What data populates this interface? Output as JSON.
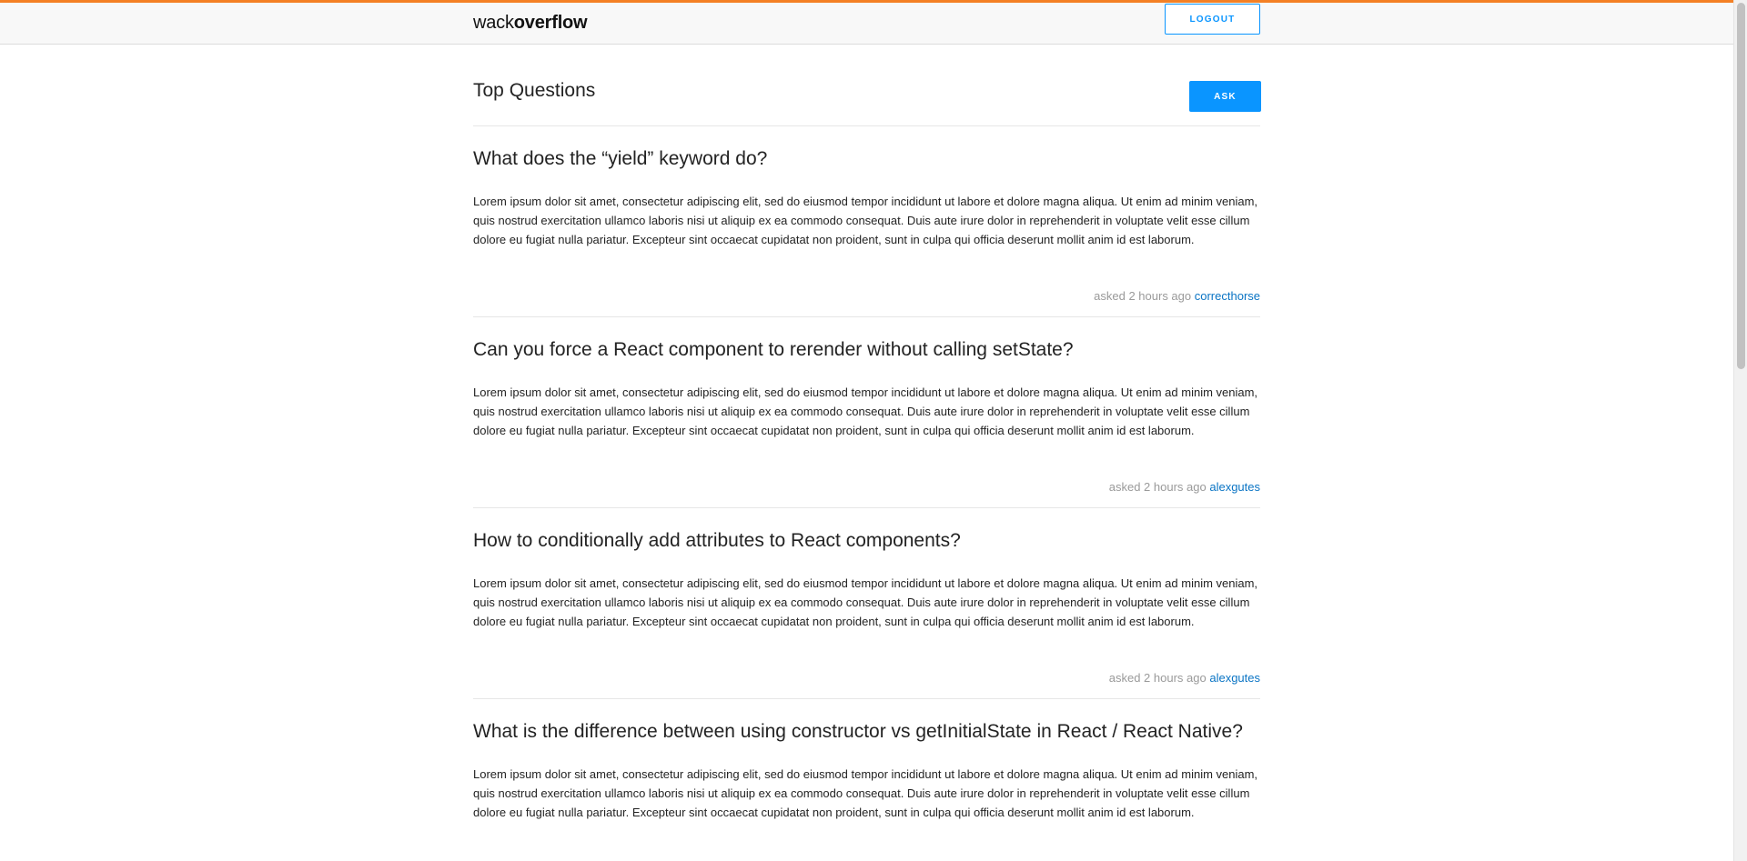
{
  "header": {
    "logo_light": "wack",
    "logo_bold": "overflow",
    "logout_label": "LOGOUT"
  },
  "main": {
    "title": "Top Questions",
    "ask_label": "ASK",
    "questions": [
      {
        "title": "What does the “yield” keyword do?",
        "body": "Lorem ipsum dolor sit amet, consectetur adipiscing elit, sed do eiusmod tempor incididunt ut labore et dolore magna aliqua. Ut enim ad minim veniam, quis nostrud exercitation ullamco laboris nisi ut aliquip ex ea commodo consequat. Duis aute irure dolor in reprehenderit in voluptate velit esse cillum dolore eu fugiat nulla pariatur. Excepteur sint occaecat cupidatat non proident, sunt in culpa qui officia deserunt mollit anim id est laborum.",
        "asked": "asked 2 hours ago",
        "author": "correcthorse"
      },
      {
        "title": "Can you force a React component to rerender without calling setState?",
        "body": "Lorem ipsum dolor sit amet, consectetur adipiscing elit, sed do eiusmod tempor incididunt ut labore et dolore magna aliqua. Ut enim ad minim veniam, quis nostrud exercitation ullamco laboris nisi ut aliquip ex ea commodo consequat. Duis aute irure dolor in reprehenderit in voluptate velit esse cillum dolore eu fugiat nulla pariatur. Excepteur sint occaecat cupidatat non proident, sunt in culpa qui officia deserunt mollit anim id est laborum.",
        "asked": "asked 2 hours ago",
        "author": "alexgutes"
      },
      {
        "title": "How to conditionally add attributes to React components?",
        "body": "Lorem ipsum dolor sit amet, consectetur adipiscing elit, sed do eiusmod tempor incididunt ut labore et dolore magna aliqua. Ut enim ad minim veniam, quis nostrud exercitation ullamco laboris nisi ut aliquip ex ea commodo consequat. Duis aute irure dolor in reprehenderit in voluptate velit esse cillum dolore eu fugiat nulla pariatur. Excepteur sint occaecat cupidatat non proident, sunt in culpa qui officia deserunt mollit anim id est laborum.",
        "asked": "asked 2 hours ago",
        "author": "alexgutes"
      },
      {
        "title": "What is the difference between using constructor vs getInitialState in React / React Native?",
        "body": "Lorem ipsum dolor sit amet, consectetur adipiscing elit, sed do eiusmod tempor incididunt ut labore et dolore magna aliqua. Ut enim ad minim veniam, quis nostrud exercitation ullamco laboris nisi ut aliquip ex ea commodo consequat. Duis aute irure dolor in reprehenderit in voluptate velit esse cillum dolore eu fugiat nulla pariatur. Excepteur sint occaecat cupidatat non proident, sunt in culpa qui officia deserunt mollit anim id est laborum."
      }
    ]
  },
  "colors": {
    "accent_orange": "#f48024",
    "primary_blue": "#0a95ff",
    "link_blue": "#0a74c4",
    "meta_gray": "#9a9a9a"
  }
}
